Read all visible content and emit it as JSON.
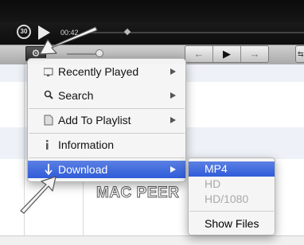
{
  "player": {
    "skip_label": "30",
    "time": "00:42",
    "progress": 0.2
  },
  "toolbar": {
    "gear_icon": "gear-icon",
    "volume_level": 0.9,
    "nav_back": "←",
    "nav_play": "▶",
    "nav_forward": "→",
    "side_label": "⇆"
  },
  "watermark": "MAC PEER",
  "menu": {
    "items": [
      {
        "label": "Recently Played",
        "icon": "monitor-icon",
        "has_submenu": true
      },
      {
        "label": "Search",
        "icon": "magnifier-icon",
        "has_submenu": true
      },
      {
        "label": "Add To Playlist",
        "icon": "document-icon",
        "has_submenu": true
      },
      {
        "label": "Information",
        "icon": "info-icon",
        "has_submenu": false
      },
      {
        "label": "Download",
        "icon": "download-arrow-icon",
        "has_submenu": true,
        "highlighted": true
      }
    ]
  },
  "submenu": {
    "items": [
      {
        "label": "MP4",
        "highlighted": true
      },
      {
        "label": "HD",
        "disabled": true
      },
      {
        "label": "HD/1080",
        "disabled": true
      },
      {
        "label": "Show Files"
      }
    ]
  },
  "colors": {
    "highlight": "#3a66dc",
    "menu_bg": "#f5f5f5"
  }
}
